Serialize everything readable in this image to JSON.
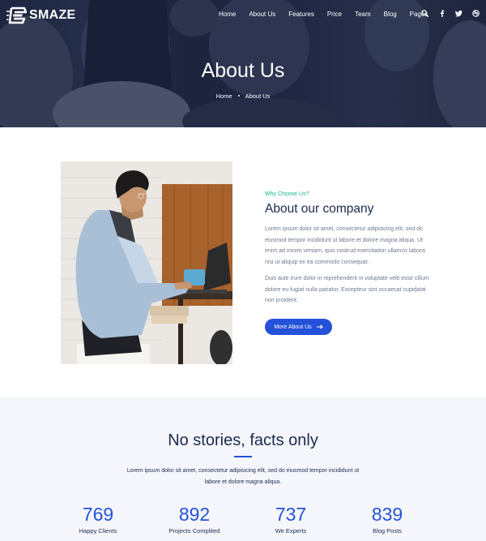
{
  "brand": {
    "name": "SMAZE"
  },
  "nav": {
    "items": [
      "Home",
      "About Us",
      "Features",
      "Price",
      "Team",
      "Blog",
      "Pages"
    ],
    "icons": [
      "search-icon",
      "facebook-icon",
      "twitter-icon",
      "dribbble-icon"
    ]
  },
  "hero": {
    "title": "About Us",
    "breadcrumb": {
      "home": "Home",
      "current": "About Us"
    }
  },
  "about": {
    "eyebrow": "Why Choose Us?",
    "heading": "About our company",
    "paragraph1": "Lorem ipsum dolor sit amet, consectetur adipisicing elit, sed do eiusmod tempor incididunt ut labore et dolore magna aliqua. Ut enim ad minim veniam, quis nostrud exercitation ullamco laboris nisi ut aliquip ex ea commodo consequat.",
    "paragraph2": "Duis aute irure dolor in reprehenderit in voluptate velit esse cillum dolore eu fugiat nulla pariatur. Excepteur sint occaecat cupidatat non proident.",
    "button_label": "More About Us"
  },
  "stats": {
    "title": "No stories, facts only",
    "description": "Lorem ipsum dolor sit amet, consectetur adipisicing elit, sed do eiusmod tempor incididunt ut labore et dolore magna aliqua.",
    "counters": [
      {
        "value": "769",
        "label": "Happy Clients"
      },
      {
        "value": "892",
        "label": "Projects Complited"
      },
      {
        "value": "737",
        "label": "We Experts"
      },
      {
        "value": "839",
        "label": "Blog Posts"
      }
    ]
  },
  "colors": {
    "accent": "#2451d9",
    "eyebrow": "#15b58c",
    "heading": "#1b2a4e",
    "stats_bg": "#f4f6fc"
  }
}
